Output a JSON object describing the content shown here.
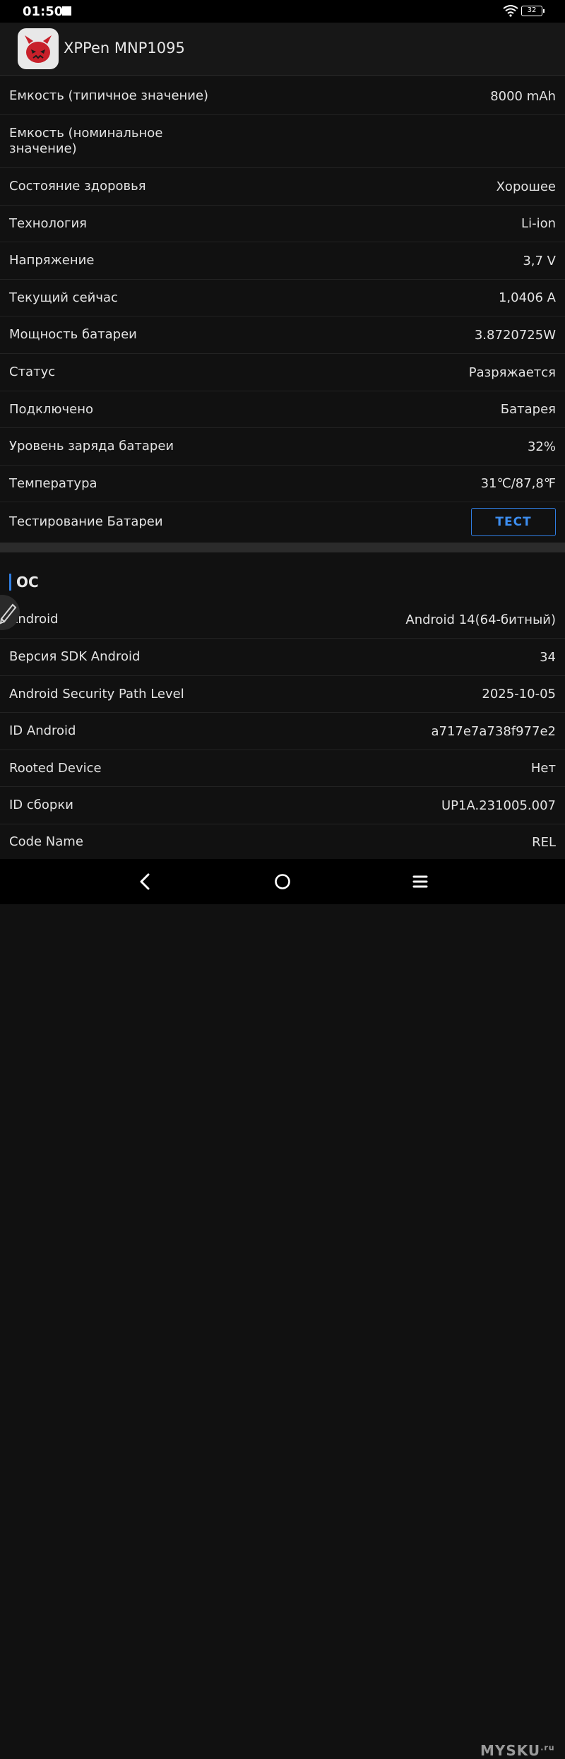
{
  "status_bar": {
    "time": "01:50",
    "battery_level": "32"
  },
  "app_bar": {
    "title": "XPPen MNP1095"
  },
  "battery_rows": [
    {
      "label": "Емкость (типичное значение)",
      "value": "8000 mAh"
    },
    {
      "label": "Емкость (номинальное значение)",
      "value": ""
    },
    {
      "label": "Состояние здоровья",
      "value": "Хорошее"
    },
    {
      "label": "Технология",
      "value": "Li-ion"
    },
    {
      "label": "Напряжение",
      "value": "3,7 V"
    },
    {
      "label": "Текущий сейчас",
      "value": "1,0406 A"
    },
    {
      "label": "Мощность батареи",
      "value": "3.8720725W"
    },
    {
      "label": "Статус",
      "value": "Разряжается"
    },
    {
      "label": "Подключено",
      "value": "Батарея"
    },
    {
      "label": "Уровень заряда батареи",
      "value": "32%"
    },
    {
      "label": "Температура",
      "value": "31℃/87,8℉"
    },
    {
      "label": "Тестирование Батареи",
      "button": "ТЕСТ"
    }
  ],
  "os_section": {
    "title": "ОС",
    "rows": [
      {
        "label": "Android",
        "value": "Android 14(64-битный)"
      },
      {
        "label": "Версия SDK Android",
        "value": "34"
      },
      {
        "label": "Android Security Path Level",
        "value": "2025-10-05"
      },
      {
        "label": "ID Android",
        "value": "a717e7a738f977e2"
      },
      {
        "label": "Rooted Device",
        "value": "Нет"
      },
      {
        "label": "ID сборки",
        "value": "UP1A.231005.007"
      },
      {
        "label": "Code Name",
        "value": "REL"
      }
    ]
  },
  "watermark": {
    "text": "MYSKU",
    "suffix": ".ru"
  },
  "colors": {
    "accent": "#2f7de1",
    "background": "#111111"
  }
}
